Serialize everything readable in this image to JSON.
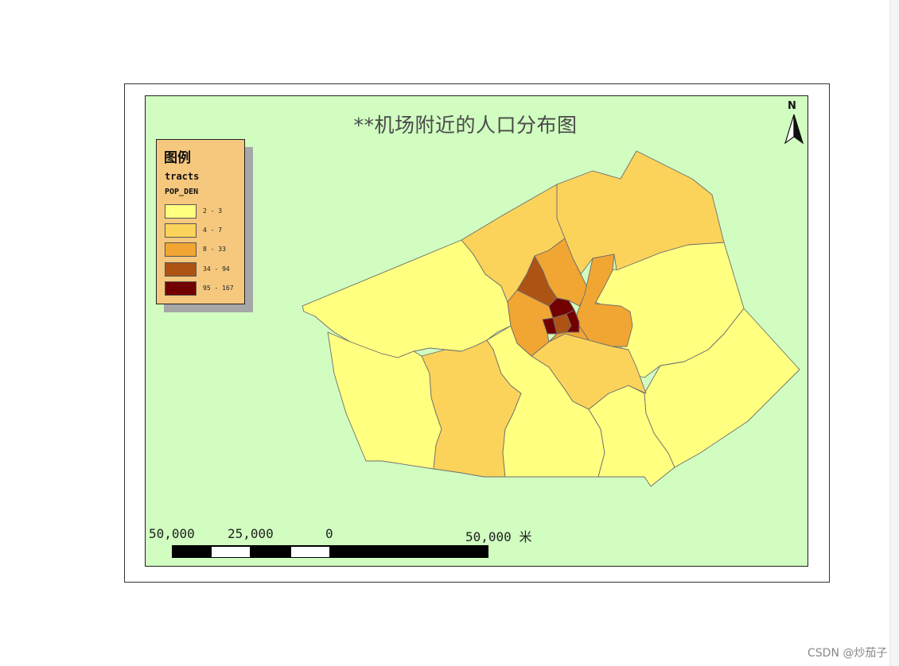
{
  "map": {
    "title": "**机场附近的人口分布图",
    "north_label": "N",
    "legend": {
      "title": "图例",
      "layer": "tracts",
      "field": "POP_DEN",
      "classes": [
        {
          "label": "2 - 3",
          "color": "#ffff80"
        },
        {
          "label": "4 - 7",
          "color": "#fbd35a"
        },
        {
          "label": "8 - 33",
          "color": "#f1a633"
        },
        {
          "label": "34 - 94",
          "color": "#ad5314"
        },
        {
          "label": "95 - 167",
          "color": "#730000"
        }
      ]
    },
    "scale_bar": {
      "labels": [
        "50,000",
        "25,000",
        "0",
        "50,000"
      ],
      "unit": "米"
    },
    "colors": {
      "map_background": "#d1fdc0",
      "boundary": "#6e6e6e"
    }
  },
  "watermark": "CSDN @炒茄子"
}
